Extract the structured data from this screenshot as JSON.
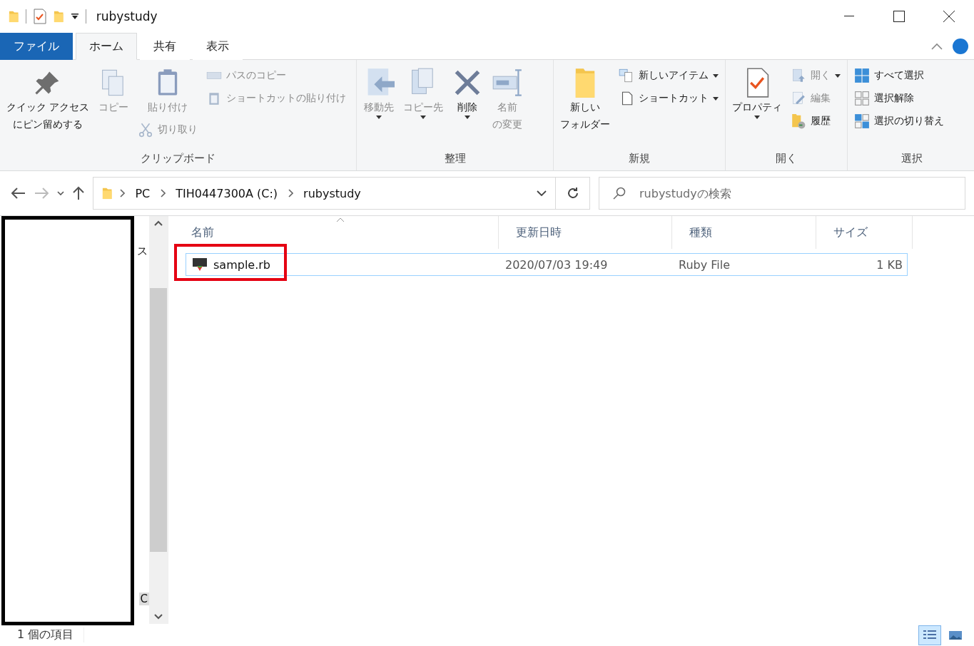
{
  "window": {
    "title": "rubystudy"
  },
  "ribbon_tabs": [
    {
      "label": "ファイル",
      "kind": "file",
      "selected": false
    },
    {
      "label": "ホーム",
      "kind": "tab",
      "selected": true
    },
    {
      "label": "共有",
      "kind": "tab",
      "selected": false
    },
    {
      "label": "表示",
      "kind": "tab",
      "selected": false
    }
  ],
  "ribbon_groups": [
    {
      "label": "クリップボード",
      "columns": [
        [
          {
            "kind": "large",
            "lines": [
              "クイック アクセス",
              "にピン留めする"
            ],
            "disabled": false
          }
        ],
        [
          {
            "kind": "large",
            "lines": [
              "コピー"
            ],
            "disabled": true
          }
        ],
        [
          {
            "kind": "large",
            "lines": [
              "貼り付け"
            ],
            "disabled": true
          },
          {
            "kind": "small",
            "lines": [
              "切り取り"
            ],
            "disabled": true
          }
        ],
        [
          {
            "kind": "small",
            "lines": [
              "パスのコピー"
            ],
            "disabled": true
          },
          {
            "kind": "small",
            "lines": [
              "ショートカットの貼り付け"
            ],
            "disabled": true
          }
        ]
      ]
    },
    {
      "label": "整理",
      "columns": [
        [
          {
            "kind": "large",
            "lines": [
              "移動先"
            ],
            "disabled": true,
            "dropdown": true
          }
        ],
        [
          {
            "kind": "large",
            "lines": [
              "コピー先"
            ],
            "disabled": true,
            "dropdown": true
          }
        ],
        [
          {
            "kind": "large",
            "lines": [
              "削除"
            ],
            "disabled": false,
            "dropdown": true
          }
        ],
        [
          {
            "kind": "large",
            "lines": [
              "名前",
              "の変更"
            ],
            "disabled": true
          }
        ]
      ]
    },
    {
      "label": "新規",
      "columns": [
        [
          {
            "kind": "large",
            "lines": [
              "新しい",
              "フォルダー"
            ],
            "disabled": false
          }
        ],
        [
          {
            "kind": "small",
            "lines": [
              "新しいアイテム"
            ],
            "disabled": false,
            "dropdown": true
          },
          {
            "kind": "small",
            "lines": [
              "ショートカット"
            ],
            "disabled": false,
            "dropdown": true
          }
        ]
      ]
    },
    {
      "label": "開く",
      "columns": [
        [
          {
            "kind": "large",
            "lines": [
              "プロパティ"
            ],
            "disabled": false,
            "dropdown": true
          }
        ],
        [
          {
            "kind": "small",
            "lines": [
              "開く"
            ],
            "disabled": true,
            "dropdown": true
          },
          {
            "kind": "small",
            "lines": [
              "編集"
            ],
            "disabled": true
          },
          {
            "kind": "small",
            "lines": [
              "履歴"
            ],
            "disabled": false
          }
        ]
      ]
    },
    {
      "label": "選択",
      "columns": [
        [
          {
            "kind": "small",
            "lines": [
              "すべて選択"
            ],
            "disabled": false
          },
          {
            "kind": "small",
            "lines": [
              "選択解除"
            ],
            "disabled": false
          },
          {
            "kind": "small",
            "lines": [
              "選択の切り替え"
            ],
            "disabled": false
          }
        ]
      ]
    }
  ],
  "address": {
    "segments": [
      "PC",
      "TIH0447300A (C:)",
      "rubystudy"
    ]
  },
  "search": {
    "placeholder": "rubystudyの検索"
  },
  "nav_pane": {
    "fragments": [
      "ス",
      "C"
    ]
  },
  "table": {
    "columns": [
      {
        "label": "名前",
        "sorted": true
      },
      {
        "label": "更新日時",
        "sorted": false
      },
      {
        "label": "種類",
        "sorted": false
      },
      {
        "label": "サイズ",
        "sorted": false
      }
    ],
    "rows": [
      {
        "name": "sample.rb",
        "date": "2020/07/03 19:49",
        "type": "Ruby File",
        "size": "1 KB",
        "selected": true,
        "highlighted": true
      }
    ]
  },
  "status_bar": {
    "text": "1 個の項目"
  },
  "view_buttons": [
    {
      "kind": "details",
      "selected": true
    },
    {
      "kind": "large-icons",
      "selected": false
    }
  ]
}
